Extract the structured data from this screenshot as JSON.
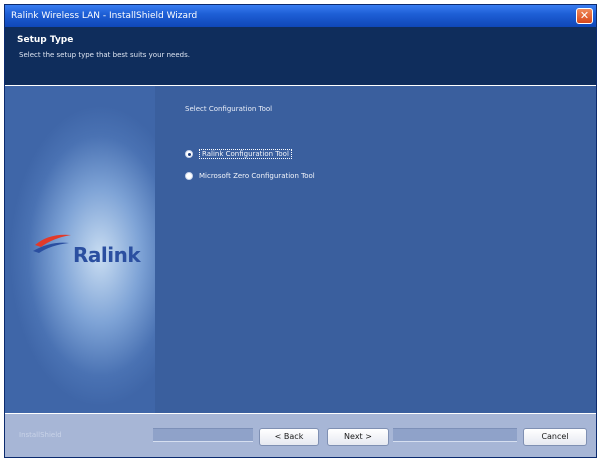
{
  "window": {
    "title": "Ralink Wireless LAN - InstallShield Wizard",
    "close_glyph": "✕"
  },
  "header": {
    "title": "Setup Type",
    "subtitle": "Select the setup type that best suits your needs."
  },
  "sidebar": {
    "logo_text": "Ralink"
  },
  "content": {
    "section_label": "Select Configuration Tool",
    "options": [
      {
        "label": "Ralink Configuration Tool",
        "selected": true
      },
      {
        "label": "Microsoft Zero Configuration Tool",
        "selected": false
      }
    ]
  },
  "footer": {
    "brand": "InstallShield",
    "back_label": "< Back",
    "next_label": "Next >",
    "cancel_label": "Cancel"
  },
  "colors": {
    "title_bar": "#1e5fd6",
    "header_bg": "#0f2d5c",
    "body_bg": "#3a5f9e",
    "footer_bg": "#a7b6d6",
    "logo_red": "#e23a2a",
    "logo_blue": "#2b4fa0"
  }
}
